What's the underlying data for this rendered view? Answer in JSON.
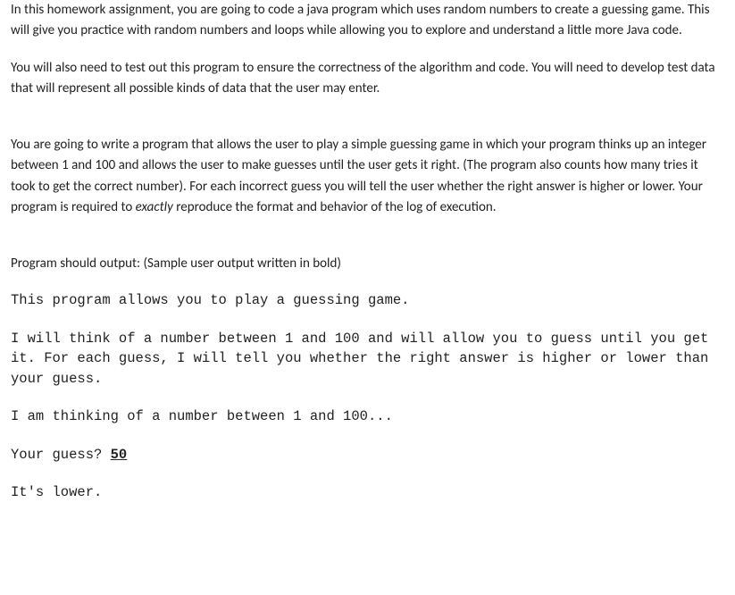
{
  "intro": {
    "p1": "In this homework assignment, you are going to code a java program which uses random numbers to create a guessing game. This will give you practice with random numbers and loops while allowing you to explore and understand a little more Java code.",
    "p2": "You will also need to test out this program to ensure the correctness of the algorithm and code. You will need to develop test data that will represent all possible kinds of data that the user may enter."
  },
  "spec": {
    "p1_a": "You are going to write a program that allows the user to play a simple guessing game in which your program thinks up an integer between 1 and 100 and allows the user to make guesses until the user gets it right.  (The program also counts how many tries it took to get the correct number).  For each incorrect guess you will tell the user whether the right answer is higher or lower.  Your program is required to ",
    "p1_exactly": "exactly",
    "p1_b": " reproduce the format and behavior of the log of execution."
  },
  "output_header": "Program should output: (Sample user output written in bold)",
  "sample": {
    "line1": "This program allows you to play a guessing game.",
    "line2": "I will think of a number between 1 and 100 and will allow you to guess until you get it.  For each guess, I will tell you whether the right answer is higher or lower than your guess.",
    "line3": "I am thinking of a number between 1 and 100...",
    "prompt1_text": "Your guess? ",
    "prompt1_input": "50",
    "line4": "It's lower."
  }
}
